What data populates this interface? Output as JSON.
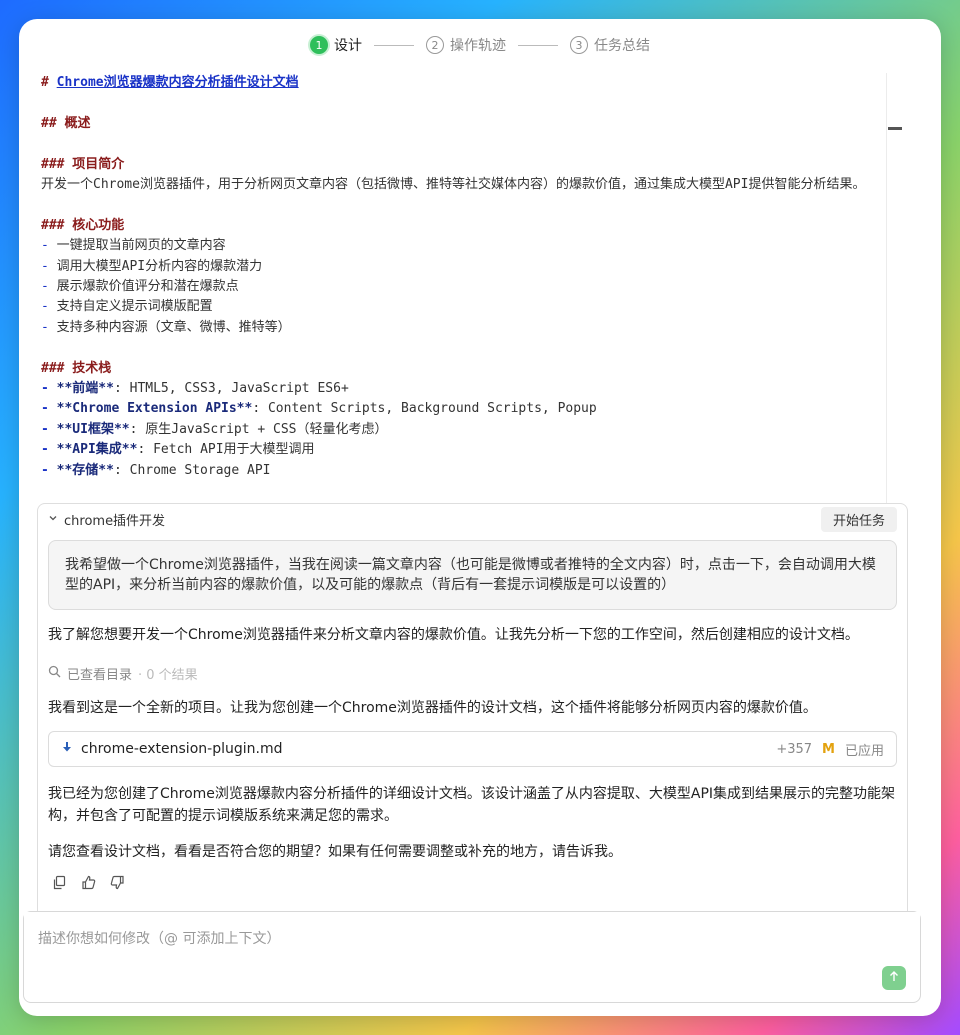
{
  "stepper": {
    "steps": [
      {
        "num": "1",
        "label": "设计"
      },
      {
        "num": "2",
        "label": "操作轨迹"
      },
      {
        "num": "3",
        "label": "任务总结"
      }
    ]
  },
  "doc": {
    "h1": "# ",
    "h1_link": "Chrome浏览器爆款内容分析插件设计文档",
    "h2_overview": "## 概述",
    "h3_intro": "### 项目简介",
    "intro_text": "开发一个Chrome浏览器插件，用于分析网页文章内容（包括微博、推特等社交媒体内容）的爆款价值，通过集成大模型API提供智能分析结果。",
    "h3_core": "### 核心功能",
    "core_items": [
      "一键提取当前网页的文章内容",
      "调用大模型API分析内容的爆款潜力",
      "展示爆款价值评分和潜在爆款点",
      "支持自定义提示词模版配置",
      "支持多种内容源（文章、微博、推特等）"
    ],
    "h3_stack": "### 技术栈",
    "stack_items": [
      {
        "key": "**前端**",
        "val": ": HTML5, CSS3, JavaScript ES6+"
      },
      {
        "key": "**Chrome Extension APIs**",
        "val": ": Content Scripts, Background Scripts, Popup"
      },
      {
        "key": "**UI框架**",
        "val": ": 原生JavaScript + CSS（轻量化考虑）"
      },
      {
        "key": "**API集成**",
        "val": ": Fetch API用于大模型调用"
      },
      {
        "key": "**存储**",
        "val": ": Chrome Storage API"
      }
    ]
  },
  "chat": {
    "title": "chrome插件开发",
    "start_button": "开始任务",
    "user_message": "我希望做一个Chrome浏览器插件，当我在阅读一篇文章内容（也可能是微博或者推特的全文内容）时，点击一下，会自动调用大模型的API，来分析当前内容的爆款价值，以及可能的爆款点（背后有一套提示词模版是可以设置的）",
    "reply_1": "我了解您想要开发一个Chrome浏览器插件来分析文章内容的爆款价值。让我先分析一下您的工作空间，然后创建相应的设计文档。",
    "search_label": "已查看目录",
    "search_result": "· 0 个结果",
    "reply_2": "我看到这是一个全新的项目。让我为您创建一个Chrome浏览器插件的设计文档，这个插件将能够分析网页内容的爆款价值。",
    "file": {
      "name": "chrome-extension-plugin.md",
      "diff": "+357",
      "status_letter": "M",
      "status": "已应用"
    },
    "reply_3": "我已经为您创建了Chrome浏览器爆款内容分析插件的详细设计文档。该设计涵盖了从内容提取、大模型API集成到结果展示的完整功能架构，并包含了可配置的提示词模版系统来满足您的需求。",
    "reply_4": "请您查看设计文档，看看是否符合您的期望？如果有任何需要调整或补充的地方，请告诉我。"
  },
  "input": {
    "placeholder": "描述你想如何修改（@ 可添加上下文）"
  },
  "colors": {
    "accent_green": "#2fbf5b",
    "heading_red": "#8a1c1c",
    "link_blue": "#1a33c7",
    "modified_orange": "#e3a20f"
  }
}
